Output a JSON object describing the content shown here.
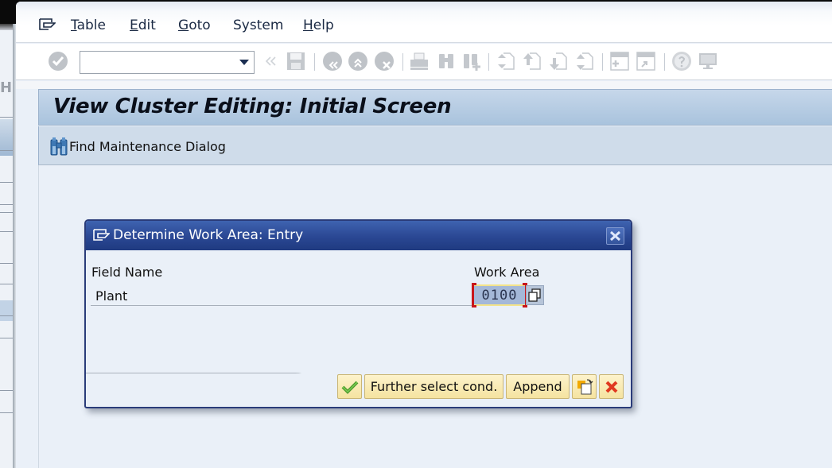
{
  "menubar": {
    "items": [
      {
        "label": "Table",
        "mnemonic": "T",
        "rest": "able"
      },
      {
        "label": "Edit",
        "mnemonic": "E",
        "rest": "dit"
      },
      {
        "label": "Goto",
        "mnemonic": "G",
        "rest": "oto"
      },
      {
        "label": "System",
        "mnemonic": "",
        "rest": "System"
      },
      {
        "label": "Help",
        "mnemonic": "H",
        "rest": "elp"
      }
    ]
  },
  "toolbar": {
    "command_field_value": "",
    "icons": [
      "enter-icon",
      "back-double-arrow-icon",
      "save-icon",
      "back-icon",
      "exit-icon",
      "cancel-icon",
      "print-icon",
      "find-icon",
      "find-next-icon",
      "first-page-icon",
      "previous-page-icon",
      "next-page-icon",
      "last-page-icon",
      "create-session-icon",
      "generate-shortcut-icon",
      "help-icon",
      "customize-layout-icon"
    ]
  },
  "screen": {
    "title": "View Cluster Editing: Initial Screen",
    "app_toolbar": {
      "find_maintenance_dialog": "Find Maintenance Dialog"
    }
  },
  "dialog": {
    "title": "Determine Work Area: Entry",
    "column_field_name": "Field Name",
    "column_work_area": "Work Area",
    "rows": [
      {
        "field": "Plant",
        "value": "0100"
      }
    ],
    "buttons": {
      "continue": "",
      "further_select": "Further select cond.",
      "append": "Append",
      "copy": "",
      "cancel": ""
    }
  },
  "colors": {
    "dialog_header": "#2a4793",
    "title_bar": "#b7cde4",
    "button_bg": "#f8e9b0",
    "field_highlight": "#a4b8d8",
    "required_marker": "#c8161b"
  }
}
